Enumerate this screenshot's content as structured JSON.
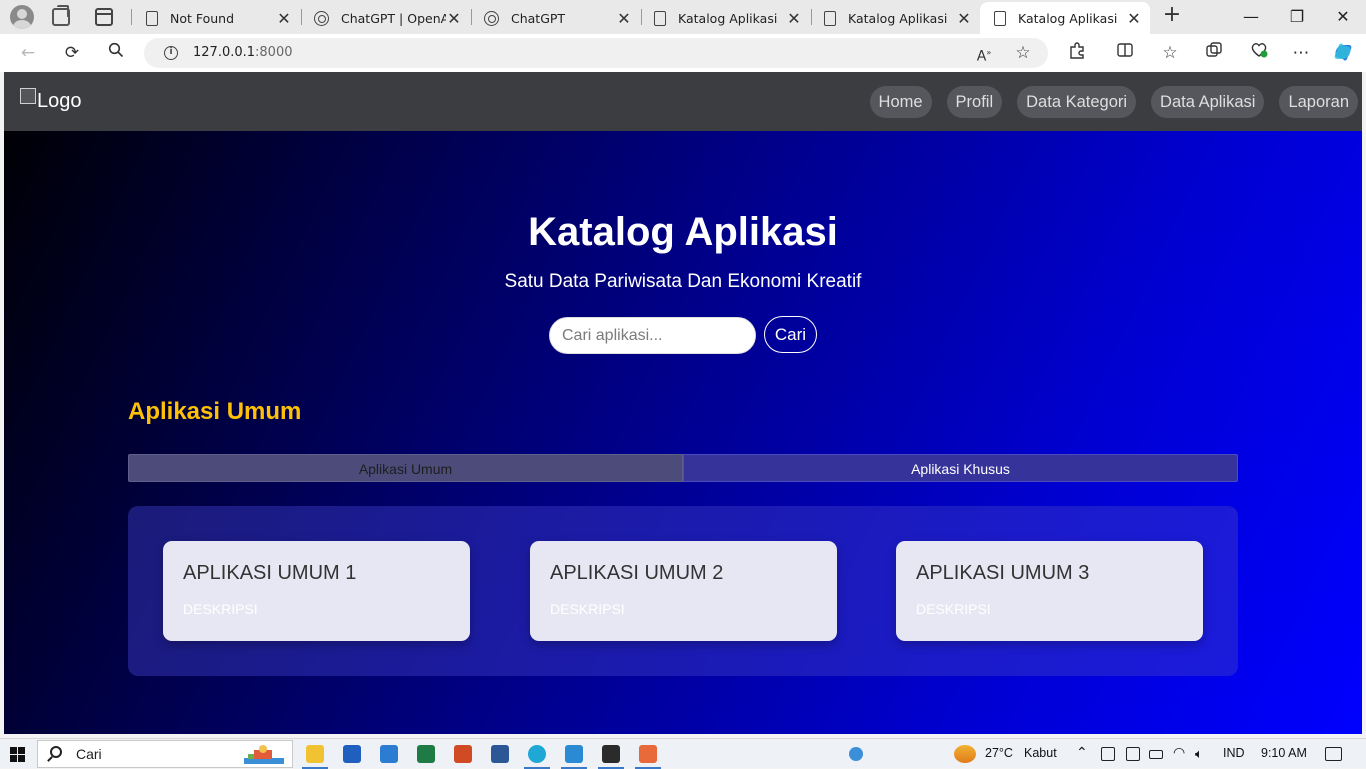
{
  "browser": {
    "tabs": [
      {
        "title": "Not Found",
        "icon": "page-icon",
        "active": false
      },
      {
        "title": "ChatGPT | OpenAI",
        "icon": "chatgpt-icon",
        "active": false
      },
      {
        "title": "ChatGPT",
        "icon": "chatgpt-icon",
        "active": false
      },
      {
        "title": "Katalog Aplikasi",
        "icon": "page-icon",
        "active": false
      },
      {
        "title": "Katalog Aplikasi",
        "icon": "page-icon",
        "active": false
      },
      {
        "title": "Katalog Aplikasi",
        "icon": "page-icon",
        "active": true
      }
    ],
    "tab_close_glyph": "✕",
    "new_tab_glyph": "+",
    "window_controls": {
      "minimize": "—",
      "restore": "❐",
      "close": "✕"
    },
    "address": {
      "host": "127.0.0.1",
      "port": ":8000"
    }
  },
  "page": {
    "logo_alt": "Logo",
    "nav": [
      "Home",
      "Profil",
      "Data Kategori",
      "Data Aplikasi",
      "Laporan"
    ],
    "hero_title": "Katalog Aplikasi",
    "hero_subtitle": "Satu Data Pariwisata Dan Ekonomi Kreatif",
    "search": {
      "placeholder": "Cari aplikasi...",
      "button": "Cari"
    },
    "section_title": "Aplikasi Umum",
    "category_tabs": [
      "Aplikasi Umum",
      "Aplikasi Khusus"
    ],
    "cards": [
      {
        "title": "APLIKASI UMUM 1",
        "description": "DESKRIPSI"
      },
      {
        "title": "APLIKASI UMUM 2",
        "description": "DESKRIPSI"
      },
      {
        "title": "APLIKASI UMUM 3",
        "description": "DESKRIPSI"
      }
    ],
    "colors": {
      "section_title": "#ffc107",
      "navbar": "#3b3d41",
      "gradient_end": "#0000ff"
    }
  },
  "taskbar": {
    "search_label": "Cari",
    "weather": {
      "temp": "27°C",
      "condition": "Kabut"
    },
    "language": "IND",
    "time": "9:10 AM"
  }
}
